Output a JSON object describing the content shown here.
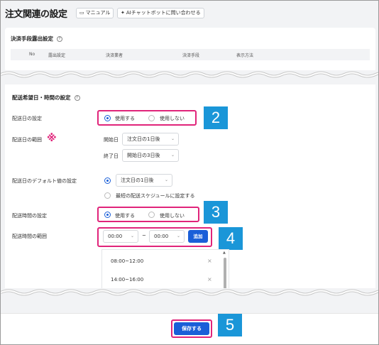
{
  "header": {
    "title": "注文関連の設定",
    "manual_label": "マニュアル",
    "ai_label": "AIチャットボットに問い合わせる"
  },
  "payment": {
    "title": "決済手段露出設定",
    "columns": [
      "No",
      "露出設定",
      "決済業者",
      "決済手段",
      "表示方法"
    ]
  },
  "delivery": {
    "title": "配送希望日・時間の設定",
    "date_setting_label": "配送日の設定",
    "date_use_label": "使用する",
    "date_nouse_label": "使用しない",
    "date_range_label": "配送日の範囲",
    "range_mark": "※",
    "start_label": "開始日",
    "start_value": "注文日の1日後",
    "end_label": "終了日",
    "end_value": "開始日の3日後",
    "default_label": "配送日のデフォルト値の設定",
    "default_value": "注文日の1日後",
    "shortest_label": "最短の配送スケジュールに設定する",
    "time_setting_label": "配送時間の設定",
    "time_use_label": "使用する",
    "time_nouse_label": "使用しない",
    "time_range_label": "配送時間の範囲",
    "time_from": "00:00",
    "tilde": "~",
    "time_to": "00:00",
    "add_label": "追加",
    "time_slots": [
      "08:00~12:00",
      "14:00~16:00"
    ]
  },
  "footer": {
    "save_label": "保存する"
  },
  "badges": [
    "2",
    "3",
    "4",
    "5"
  ],
  "colors": {
    "accent": "#1a5fd8",
    "highlight": "#e0247a",
    "badge": "#1a96d8"
  }
}
